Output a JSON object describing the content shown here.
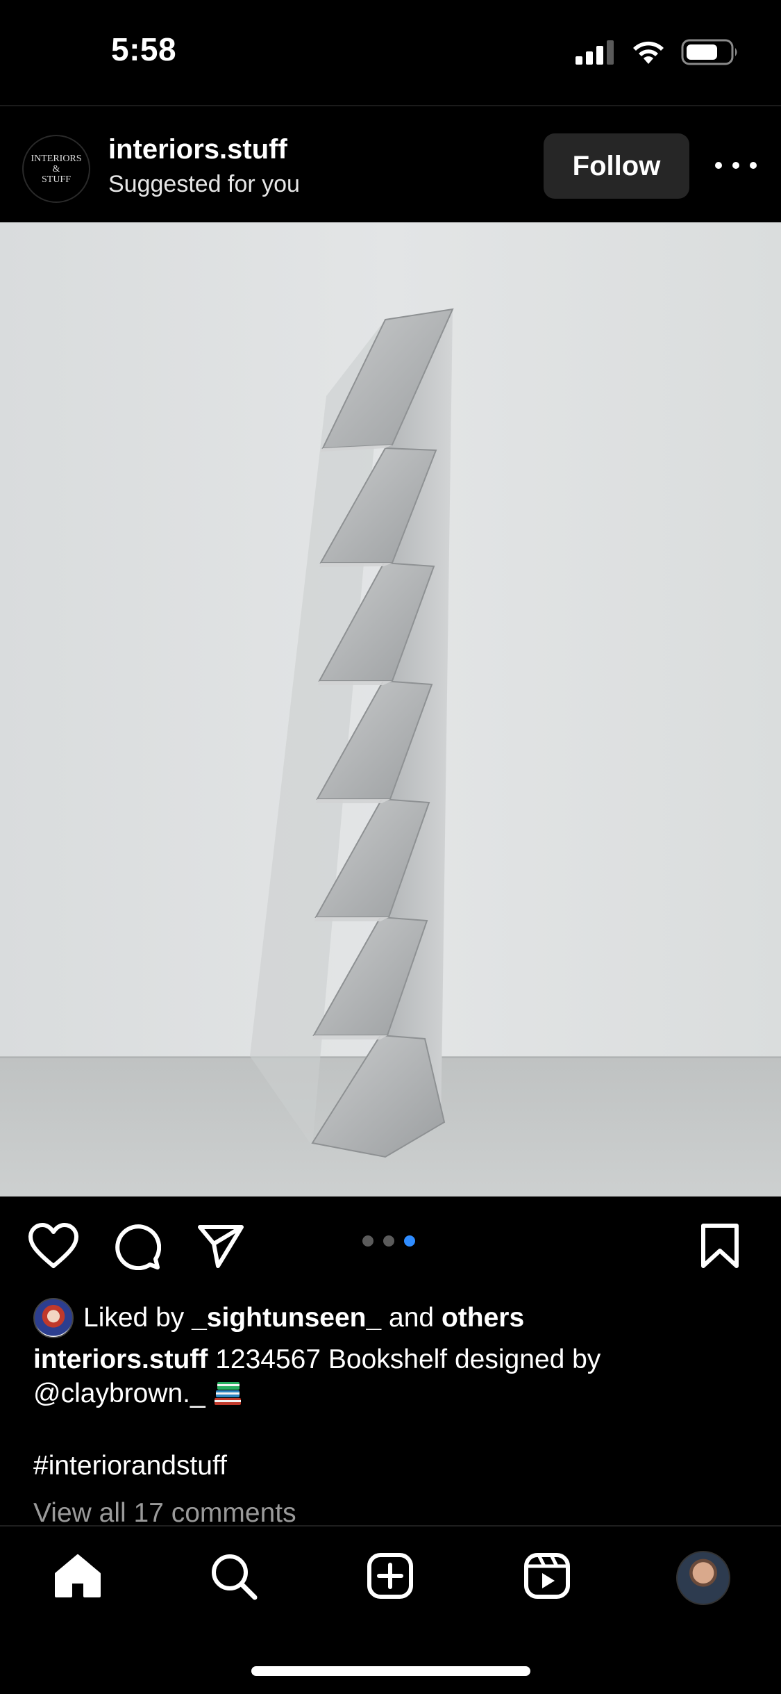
{
  "status_bar": {
    "time": "5:58"
  },
  "post": {
    "account": {
      "username": "interiors.stuff",
      "subtitle": "Suggested for you",
      "logo_lines": [
        "INTERIORS",
        "&",
        "STUFF"
      ]
    },
    "follow_label": "Follow",
    "carousel": {
      "count": 3,
      "active_index": 2
    },
    "likes": {
      "prefix": "Liked by",
      "liker": "_sightunseen_",
      "conjunction": "and",
      "others": "others"
    },
    "caption": {
      "username": "interiors.stuff",
      "text": "1234567 Bookshelf designed by @claybrown._"
    },
    "hashtag": "#interiorandstuff",
    "comments_link": "View all 17 comments"
  },
  "icons": {
    "like": "heart-icon",
    "comment": "comment-icon",
    "share": "send-icon",
    "save": "bookmark-icon",
    "more": "more-icon"
  },
  "tab_bar": [
    "home-icon",
    "search-icon",
    "create-icon",
    "reels-icon",
    "profile-avatar"
  ],
  "colors": {
    "background": "#000000",
    "follow_button": "#262626",
    "active_dot": "#2f8cff"
  }
}
